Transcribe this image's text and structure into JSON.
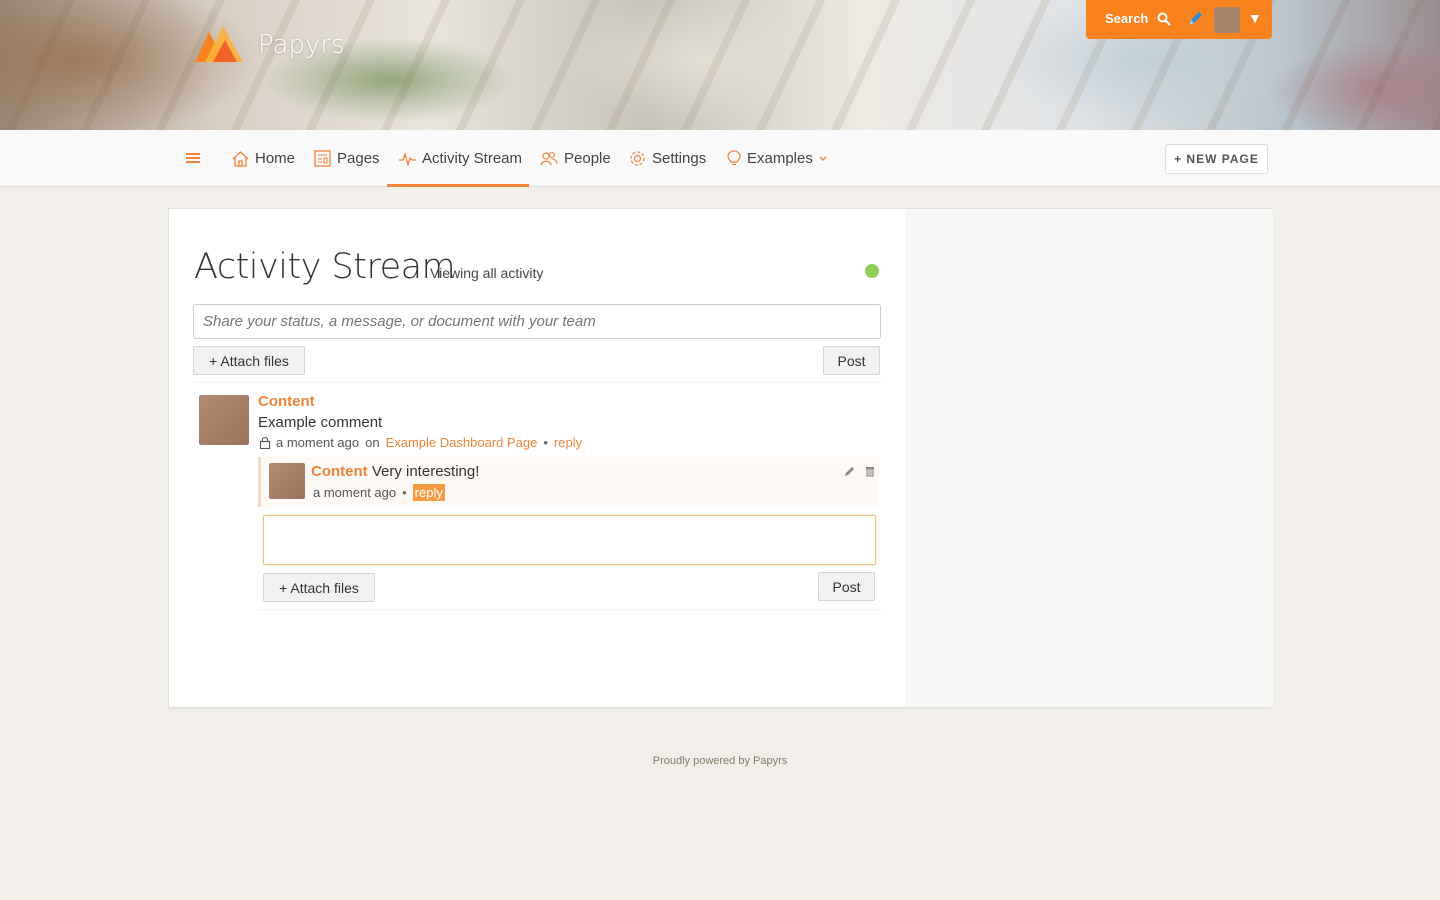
{
  "app": {
    "brand": "Papyrs"
  },
  "topbar": {
    "search_label": "Search"
  },
  "nav": {
    "items": [
      {
        "label": "Home"
      },
      {
        "label": "Pages"
      },
      {
        "label": "Activity Stream"
      },
      {
        "label": "People"
      },
      {
        "label": "Settings"
      },
      {
        "label": "Examples"
      }
    ],
    "new_page_label": "+ NEW PAGE"
  },
  "main": {
    "title": "Activity Stream",
    "subtitle": "Viewing all activity",
    "share_placeholder": "Share your status, a message, or document with your team",
    "attach_label": "+  Attach files",
    "post_label": "Post"
  },
  "activity": {
    "author": "Content",
    "comment": "Example comment",
    "time": "a moment ago",
    "on_label": "on",
    "target": "Example Dashboard Page",
    "reply_label": "reply",
    "replies": [
      {
        "author": "Content",
        "text": "Very interesting!",
        "time": "a moment ago",
        "reply_label": "reply"
      }
    ],
    "reply_attach_label": "+  Attach files",
    "reply_post_label": "Post"
  },
  "colors": {
    "accent": "#f0833a",
    "topbar": "#f7821e",
    "status_online": "#8ecf5a"
  },
  "footer": {
    "text": "Proudly powered by Papyrs"
  }
}
